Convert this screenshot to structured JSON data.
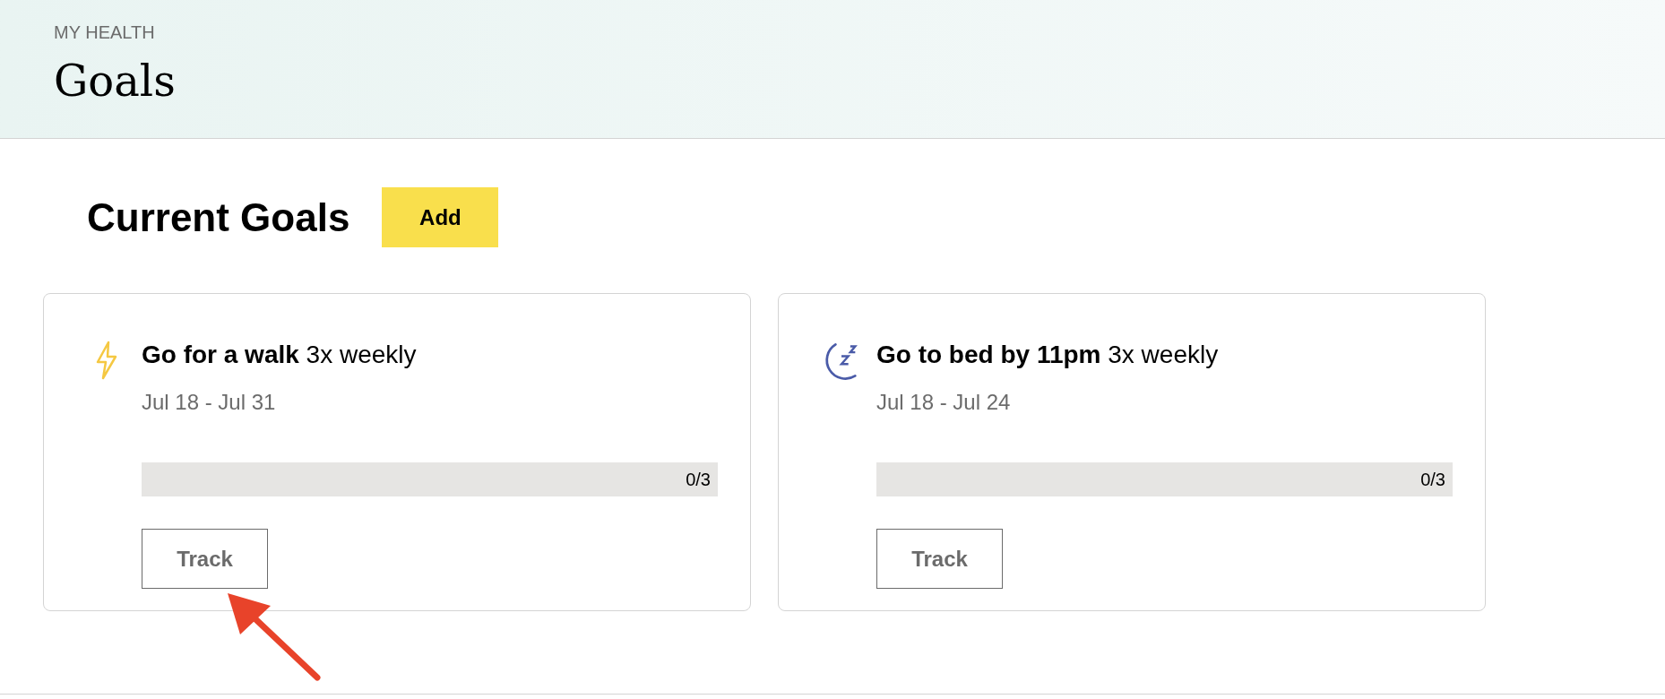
{
  "header": {
    "eyebrow": "MY HEALTH",
    "title": "Goals"
  },
  "section": {
    "title": "Current Goals",
    "add_button": "Add"
  },
  "goals": [
    {
      "kind": "bolt",
      "title": "**Go for a walk** 3x weekly",
      "dates": "Jul 18 - Jul 31",
      "level": 0,
      "progress": "0/3",
      "button": "Track"
    },
    {
      "kind": "moon",
      "title": "**Go to bed by 11pm** 3x weekly",
      "dates": "Jul 18 - Jul 24",
      "level": 0,
      "progress": "0/3",
      "button": "Track"
    }
  ]
}
